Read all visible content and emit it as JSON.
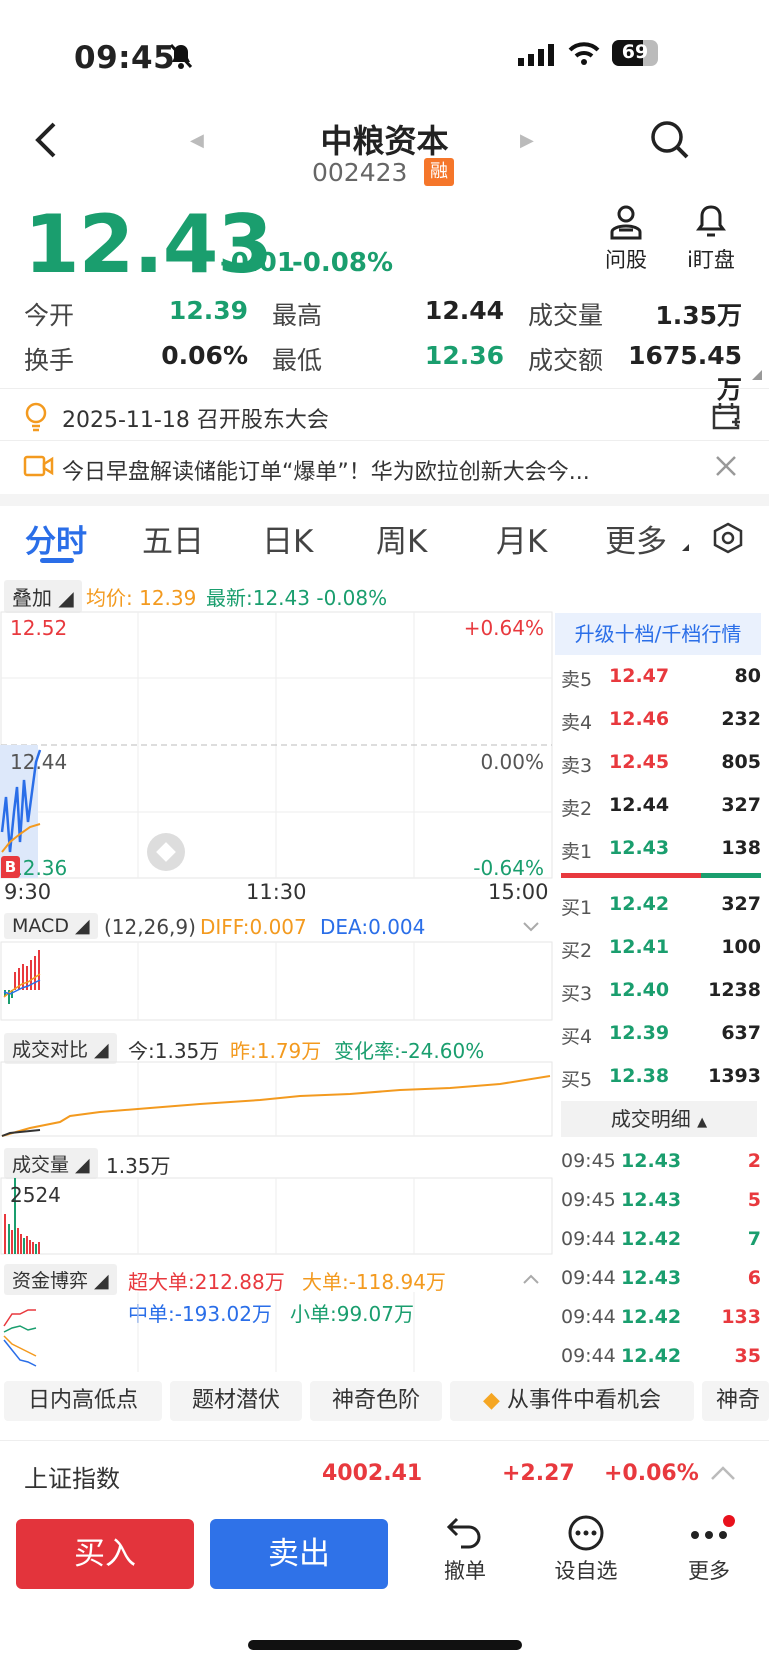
{
  "status_bar": {
    "time": "09:45",
    "battery": "69"
  },
  "header": {
    "name": "中粮资本",
    "code": "002423",
    "margin_badge": "融"
  },
  "quote": {
    "price": "12.43",
    "change": "-0.01",
    "change_pct": "-0.08%"
  },
  "actions": {
    "ask": "问股",
    "watch": "i盯盘"
  },
  "stats": {
    "open_label": "今开",
    "open": "12.39",
    "high_label": "最高",
    "high": "12.44",
    "volume_label": "成交量",
    "volume": "1.35万",
    "turnover_label": "换手",
    "turnover": "0.06%",
    "low_label": "最低",
    "low": "12.36",
    "amount_label": "成交额",
    "amount": "1675.45万"
  },
  "notices": {
    "meeting": "2025-11-18 召开股东大会",
    "news": "今日早盘解读储能订单“爆单”！华为欧拉创新大会今..."
  },
  "tabs": [
    "分时",
    "五日",
    "日K",
    "周K",
    "月K",
    "更多"
  ],
  "overlay_bar": {
    "chip": "叠加",
    "avg": "均价: 12.39",
    "latest": "最新:12.43 -0.08%"
  },
  "price_chart": {
    "y_top": "12.52",
    "y_mid": "12.44",
    "y_bot": "12.36",
    "pct_top": "+0.64%",
    "pct_mid": "0.00%",
    "pct_bot": "-0.64%",
    "x_start": "9:30",
    "x_mid": "11:30",
    "x_end": "15:00",
    "marker": "B"
  },
  "macd": {
    "chip": "MACD",
    "params": "(12,26,9)",
    "diff": "DIFF:0.007",
    "dea": "DEA:0.004"
  },
  "volume_compare": {
    "chip": "成交对比",
    "today": "今:1.35万",
    "yesterday": "昨:1.79万",
    "change": "变化率:-24.60%"
  },
  "volume": {
    "chip": "成交量",
    "value": "1.35万",
    "max": "2524"
  },
  "fund_flow": {
    "chip": "资金博弈",
    "super": "超大单:212.88万",
    "large": "大单:-118.94万",
    "mid": "中单:-193.02万",
    "small": "小单:99.07万"
  },
  "order_book": {
    "upgrade": "升级十档/千档行情",
    "asks": [
      {
        "label": "卖5",
        "price": "12.47",
        "vol": "80"
      },
      {
        "label": "卖4",
        "price": "12.46",
        "vol": "232"
      },
      {
        "label": "卖3",
        "price": "12.45",
        "vol": "805"
      },
      {
        "label": "卖2",
        "price": "12.44",
        "vol": "327"
      },
      {
        "label": "卖1",
        "price": "12.43",
        "vol": "138"
      }
    ],
    "bids": [
      {
        "label": "买1",
        "price": "12.42",
        "vol": "327"
      },
      {
        "label": "买2",
        "price": "12.41",
        "vol": "100"
      },
      {
        "label": "买3",
        "price": "12.40",
        "vol": "1238"
      },
      {
        "label": "买4",
        "price": "12.39",
        "vol": "637"
      },
      {
        "label": "买5",
        "price": "12.38",
        "vol": "1393"
      }
    ],
    "detail_label": "成交明细",
    "trades": [
      {
        "time": "09:45",
        "price": "12.43",
        "vol": "2"
      },
      {
        "time": "09:45",
        "price": "12.43",
        "vol": "5"
      },
      {
        "time": "09:44",
        "price": "12.42",
        "vol": "7"
      },
      {
        "time": "09:44",
        "price": "12.43",
        "vol": "6"
      },
      {
        "time": "09:44",
        "price": "12.42",
        "vol": "133"
      },
      {
        "time": "09:44",
        "price": "12.42",
        "vol": "35"
      }
    ]
  },
  "feature_pills": [
    "日内高低点",
    "题材潜伏",
    "神奇色阶",
    "从事件中看机会",
    "神奇"
  ],
  "index_bar": {
    "name": "上证指数",
    "value": "4002.41",
    "change": "+2.27",
    "pct": "+0.06%"
  },
  "bottom": {
    "buy": "买入",
    "sell": "卖出",
    "cancel": "撤单",
    "watchlist": "设自选",
    "more": "更多"
  }
}
